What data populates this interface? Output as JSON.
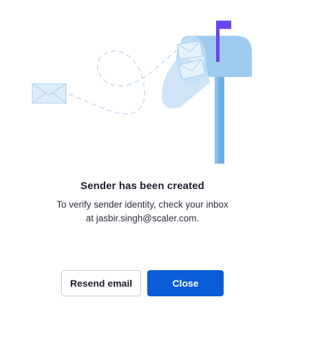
{
  "dialog": {
    "title": "Sender has been created",
    "message_line1": "To verify sender identity, check your inbox",
    "message_line2": "at jasbir.singh@scaler.com.",
    "resend_label": "Resend email",
    "close_label": "Close"
  },
  "colors": {
    "primary": "#0a5dd6",
    "mailbox": "#9ecbef",
    "mailbox_dark": "#6aaee5",
    "flag": "#6b46f0",
    "envelope": "#dcecf9"
  }
}
